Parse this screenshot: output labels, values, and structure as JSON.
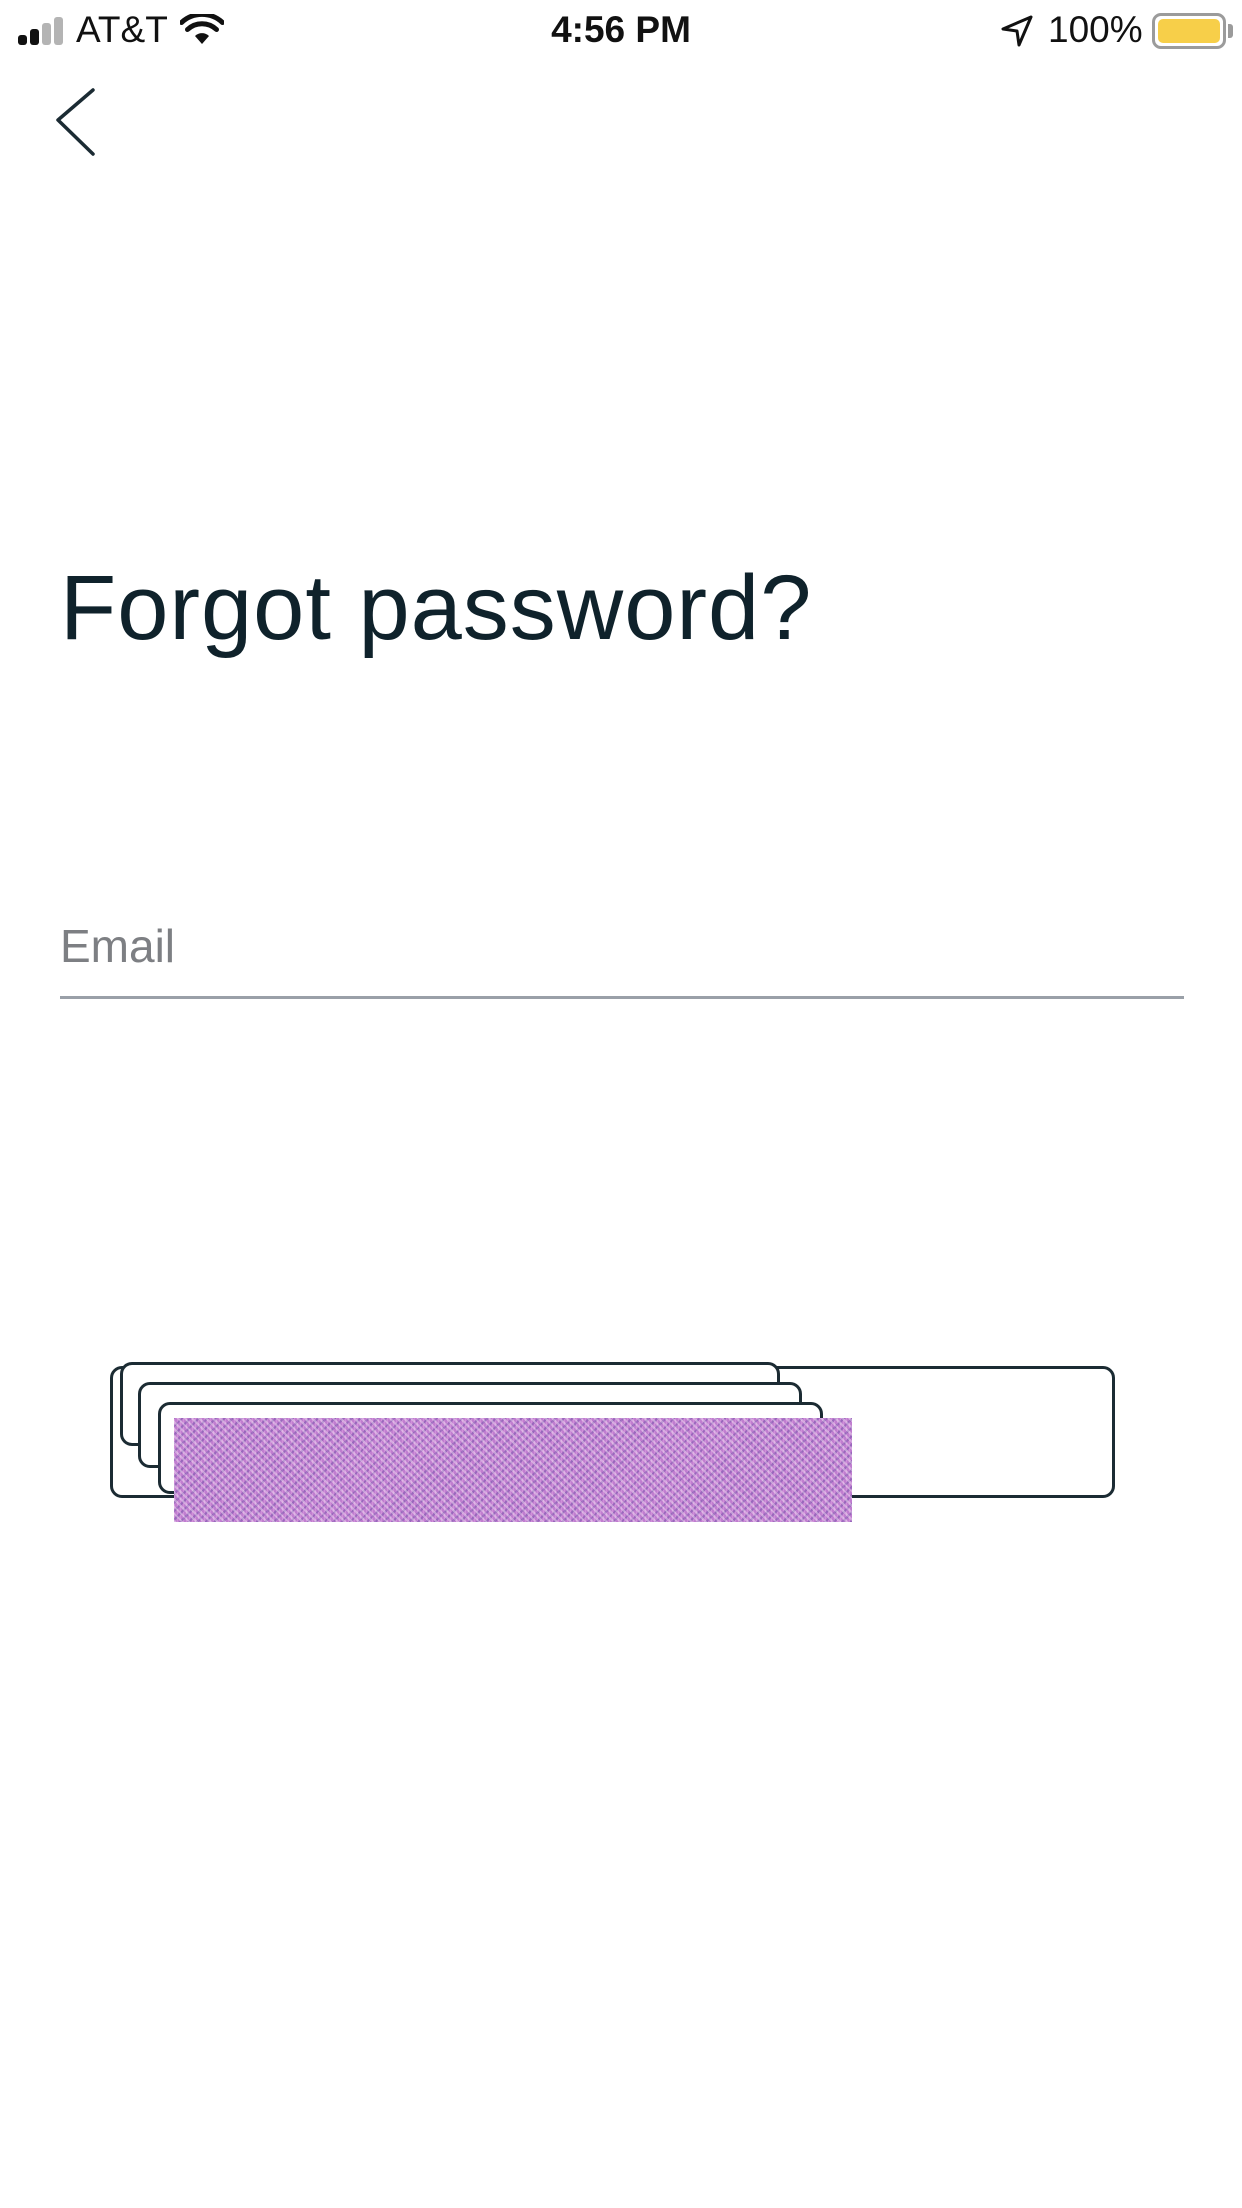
{
  "status_bar": {
    "carrier": "AT&T",
    "time": "4:56 PM",
    "battery_percent": "100%",
    "signal_bars": 4,
    "signal_bars_filled": 2,
    "battery_level": 1.0,
    "battery_color": "#f7cf49",
    "signal_color": "#111111",
    "signal_dim_color": "#b4b4b4",
    "icons": [
      "signal-icon",
      "wifi-icon",
      "location-arrow-icon",
      "battery-icon"
    ]
  },
  "navigation": {
    "back_icon": "chevron-left-icon"
  },
  "form": {
    "title": "Forgot password?",
    "email_placeholder": "Email",
    "email_value": "",
    "submit_label": ""
  },
  "colors": {
    "title": "#0f222b",
    "field_underline": "#9aa0a8",
    "placeholder": "#7d7f83",
    "button_border": "#1b2b33"
  }
}
